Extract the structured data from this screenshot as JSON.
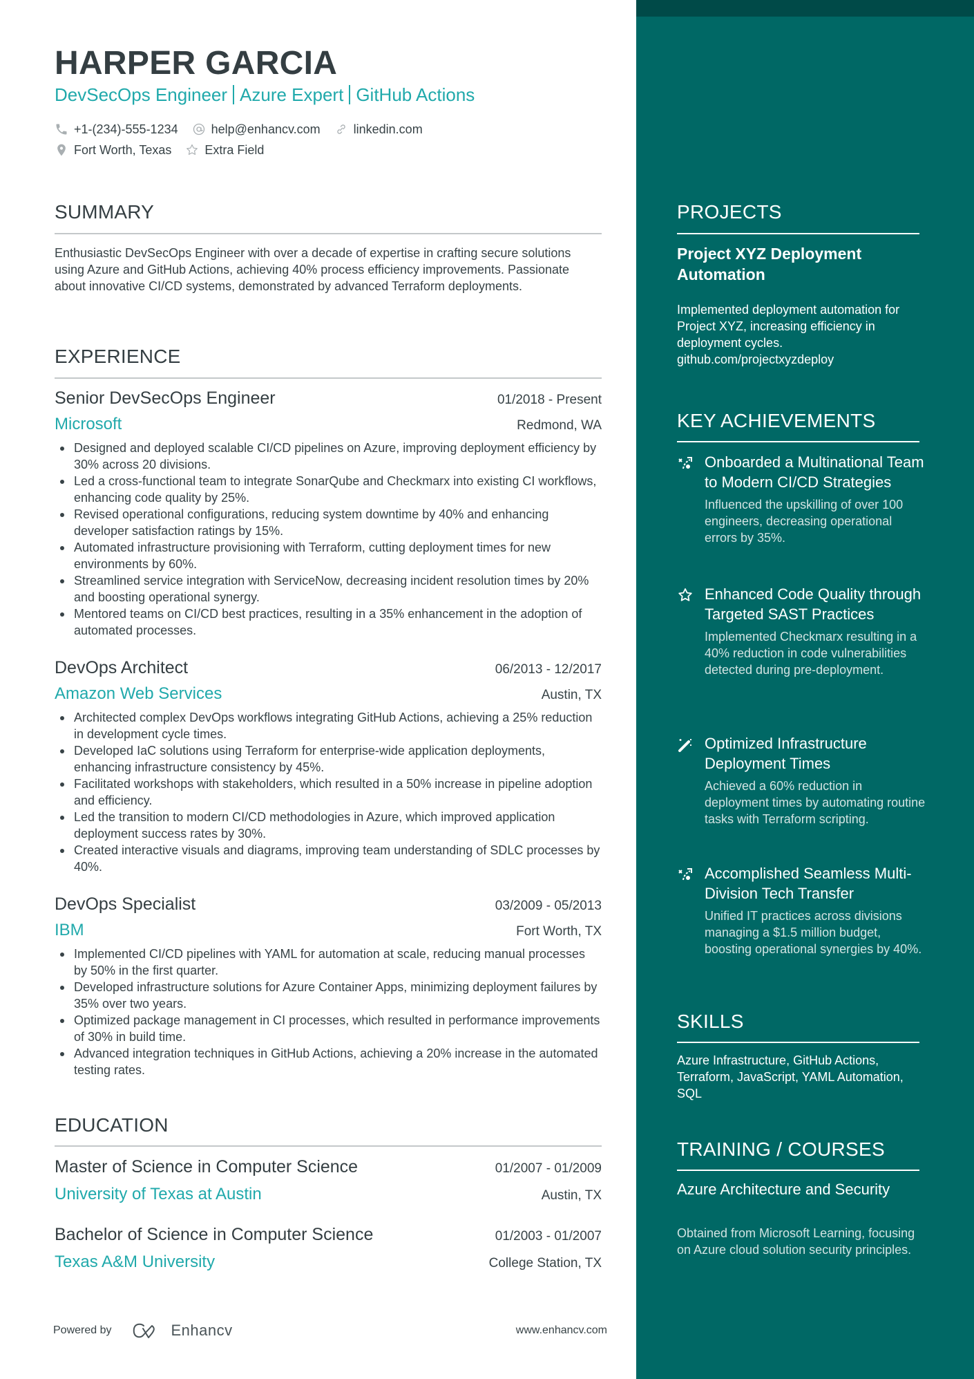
{
  "colors": {
    "accent": "#20a9ab",
    "sidebar_bg": "#006865",
    "sidebar_top": "#004a48",
    "text": "#384347"
  },
  "header": {
    "name": "HARPER GARCIA",
    "headline": [
      "DevSecOps Engineer",
      "Azure Expert",
      "GitHub Actions"
    ],
    "contacts": {
      "phone": {
        "icon": "phone-icon",
        "text": "+1-(234)-555-1234"
      },
      "email": {
        "icon": "at-icon",
        "text": "help@enhancv.com"
      },
      "link": {
        "icon": "link-icon",
        "text": "linkedin.com"
      },
      "location": {
        "icon": "location-pin-icon",
        "text": "Fort Worth, Texas"
      },
      "extra": {
        "icon": "star-icon",
        "text": "Extra Field"
      }
    }
  },
  "summary": {
    "title": "SUMMARY",
    "text": "Enthusiastic DevSecOps Engineer with over a decade of expertise in crafting secure solutions using Azure and GitHub Actions, achieving 40% process efficiency improvements. Passionate about innovative CI/CD systems, demonstrated by advanced Terraform deployments."
  },
  "experience": {
    "title": "EXPERIENCE",
    "jobs": [
      {
        "title": "Senior DevSecOps Engineer",
        "dates": "01/2018 - Present",
        "company": "Microsoft",
        "location": "Redmond, WA",
        "bullets": [
          "Designed and deployed scalable CI/CD pipelines on Azure, improving deployment efficiency by 30% across 20 divisions.",
          "Led a cross-functional team to integrate SonarQube and Checkmarx into existing CI workflows, enhancing code quality by 25%.",
          "Revised operational configurations, reducing system downtime by 40% and enhancing developer satisfaction ratings by 15%.",
          "Automated infrastructure provisioning with Terraform, cutting deployment times for new environments by 60%.",
          "Streamlined service integration with ServiceNow, decreasing incident resolution times by 20% and boosting operational synergy.",
          "Mentored teams on CI/CD best practices, resulting in a 35% enhancement in the adoption of automated processes."
        ]
      },
      {
        "title": "DevOps Architect",
        "dates": "06/2013 - 12/2017",
        "company": "Amazon Web Services",
        "location": "Austin, TX",
        "bullets": [
          "Architected complex DevOps workflows integrating GitHub Actions, achieving a 25% reduction in development cycle times.",
          "Developed IaC solutions using Terraform for enterprise-wide application deployments, enhancing infrastructure consistency by 45%.",
          "Facilitated workshops with stakeholders, which resulted in a 50% increase in pipeline adoption and efficiency.",
          "Led the transition to modern CI/CD methodologies in Azure, which improved application deployment success rates by 30%.",
          "Created interactive visuals and diagrams, improving team understanding of SDLC processes by 40%."
        ]
      },
      {
        "title": "DevOps Specialist",
        "dates": "03/2009 - 05/2013",
        "company": "IBM",
        "location": "Fort Worth, TX",
        "bullets": [
          "Implemented CI/CD pipelines with YAML for automation at scale, reducing manual processes by 50% in the first quarter.",
          "Developed infrastructure solutions for Azure Container Apps, minimizing deployment failures by 35% over two years.",
          "Optimized package management in CI processes, which resulted in performance improvements of 30% in build time.",
          "Advanced integration techniques in GitHub Actions, achieving a 20% increase in the automated testing rates."
        ]
      }
    ]
  },
  "education": {
    "title": "EDUCATION",
    "items": [
      {
        "degree": "Master of Science in Computer Science",
        "dates": "01/2007 - 01/2009",
        "school": "University of Texas at Austin",
        "location": "Austin, TX"
      },
      {
        "degree": "Bachelor of Science in Computer Science",
        "dates": "01/2003 - 01/2007",
        "school": "Texas A&M University",
        "location": "College Station, TX"
      }
    ]
  },
  "footer": {
    "powered_by": "Powered by",
    "brand": "Enhancv",
    "website": "www.enhancv.com"
  },
  "projects": {
    "title": "PROJECTS",
    "items": [
      {
        "title": "Project XYZ Deployment Automation",
        "description": "Implemented deployment automation for Project XYZ, increasing efficiency in deployment cycles.",
        "link": "github.com/projectxyzdeploy"
      }
    ]
  },
  "achievements": {
    "title": "KEY ACHIEVEMENTS",
    "items": [
      {
        "icon": "strategy-arrow-icon",
        "title": "Onboarded a Multinational Team to Modern CI/CD Strategies",
        "description": "Influenced the upskilling of over 100 engineers, decreasing operational errors by 35%."
      },
      {
        "icon": "star-icon",
        "title": "Enhanced Code Quality through Targeted SAST Practices",
        "description": "Implemented Checkmarx resulting in a 40% reduction in code vulnerabilities detected during pre-deployment."
      },
      {
        "icon": "magic-wand-icon",
        "title": "Optimized Infrastructure Deployment Times",
        "description": "Achieved a 60% reduction in deployment times by automating routine tasks with Terraform scripting."
      },
      {
        "icon": "strategy-arrow-icon",
        "title": "Accomplished Seamless Multi-Division Tech Transfer",
        "description": "Unified IT practices across divisions managing a $1.5 million budget, boosting operational synergies by 40%."
      }
    ]
  },
  "skills": {
    "title": "SKILLS",
    "text": "Azure Infrastructure, GitHub Actions, Terraform, JavaScript, YAML Automation, SQL"
  },
  "training": {
    "title": "TRAINING / COURSES",
    "items": [
      {
        "title": "Azure Architecture and Security",
        "description": "Obtained from Microsoft Learning, focusing on Azure cloud solution security principles."
      }
    ]
  }
}
